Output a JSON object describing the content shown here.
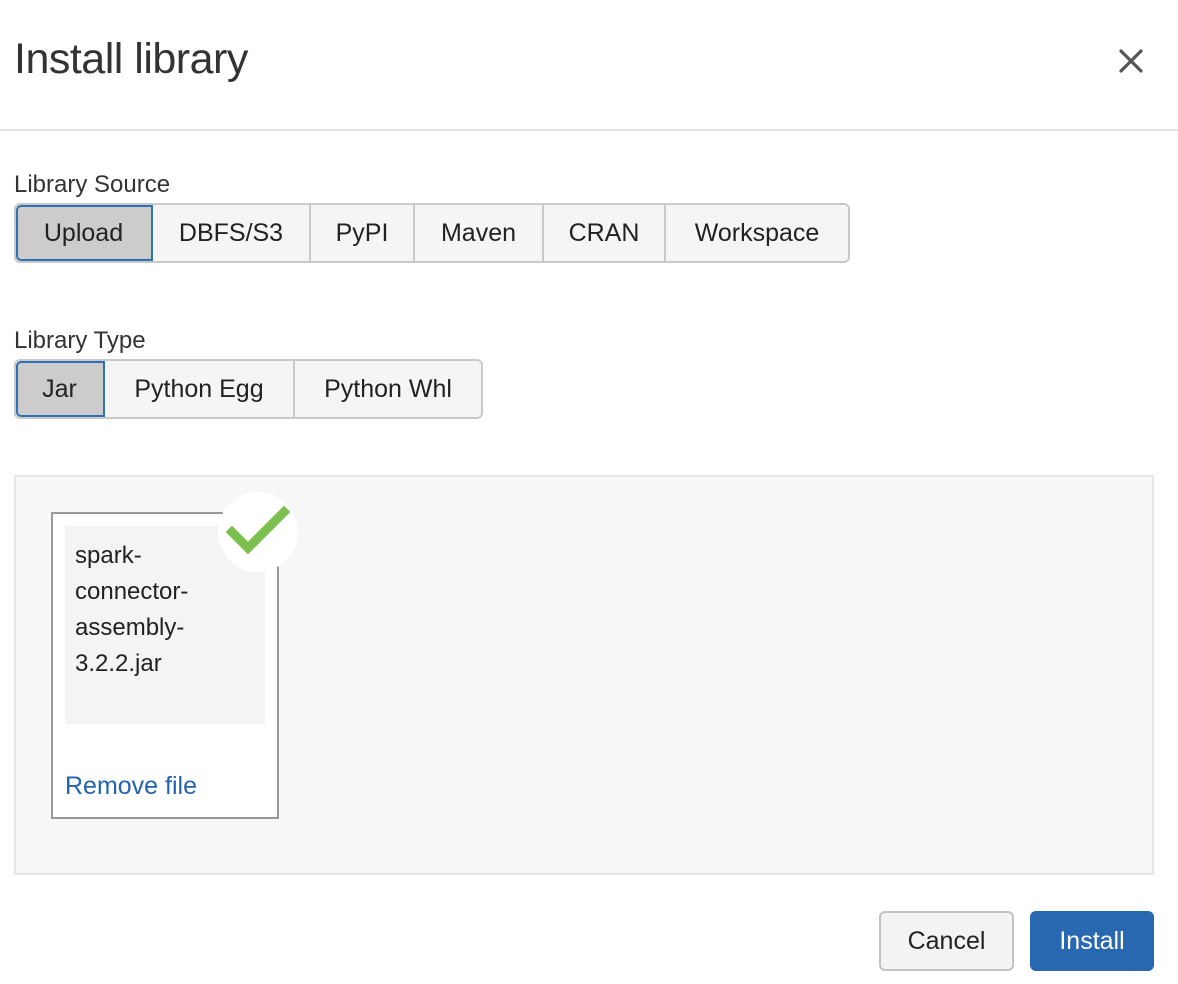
{
  "dialog": {
    "title": "Install library",
    "close_icon": "close-icon"
  },
  "library_source": {
    "label": "Library Source",
    "selected": "Upload",
    "options": [
      "Upload",
      "DBFS/S3",
      "PyPI",
      "Maven",
      "CRAN",
      "Workspace"
    ]
  },
  "library_type": {
    "label": "Library Type",
    "selected": "Jar",
    "options": [
      "Jar",
      "Python Egg",
      "Python Whl"
    ]
  },
  "upload": {
    "file_name": "spark-connector-assembly-3.2.2.jar",
    "status_icon": "check-icon",
    "remove_label": "Remove file"
  },
  "footer": {
    "cancel_label": "Cancel",
    "install_label": "Install"
  },
  "colors": {
    "primary": "#2768b1",
    "link": "#2463ad",
    "success": "#7cc14f",
    "active_segment": "#cccccc"
  }
}
